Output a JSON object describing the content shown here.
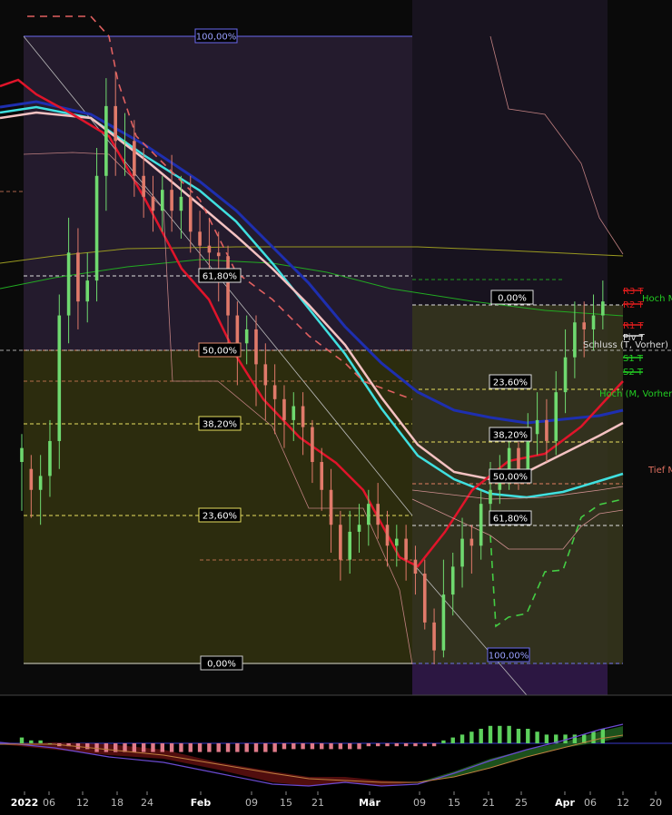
{
  "chart_data": {
    "type": "candlestick",
    "colors": {
      "background": "#000000",
      "up_candle": "#6fd96f",
      "down_candle": "#e07a6a",
      "ema_fast": "#e0142a",
      "ema_slow": "#f4c2c2",
      "ma_blue": "#1e2fb0",
      "ma_cyan": "#40e0e0",
      "ma_green_long": "#22aa22",
      "ma_olive": "#9a9a20",
      "fib_upper_box": "#3a2a4a",
      "fib_lower_box": "#3a3a10",
      "fib_right_box": "#3a3a1e",
      "fib_label_bg": "#000000",
      "pivot_resistance": "#e01c1c",
      "pivot_support": "#22cc22",
      "macd_pos": "#5cd05c",
      "macd_neg": "#e07a8a"
    },
    "x_ticks": [
      "2022",
      "06",
      "12",
      "18",
      "24",
      "Feb",
      "09",
      "15",
      "21",
      "Mär",
      "09",
      "15",
      "21",
      "25",
      "Apr",
      "06",
      "12",
      "20"
    ],
    "fib_levels_left": [
      "100,00%",
      "61,80%",
      "50,00%",
      "38,20%",
      "23,60%",
      "0,00%"
    ],
    "fib_levels_right": [
      "0,00%",
      "23,60%",
      "38,20%",
      "50,00%",
      "61,80%",
      "100,00%"
    ],
    "pivot_labels": [
      "R3 T",
      "R2 T",
      "R1 T",
      "Piv T",
      "S1 T",
      "S2 T"
    ],
    "line_labels": [
      "Hoch M",
      "Schluss (T, Vorher)",
      "Hoch (M, Vorher)",
      "Tief M"
    ],
    "candles": [
      [
        22,
        58,
        62,
        44,
        66
      ],
      [
        24,
        56,
        50,
        42,
        60
      ],
      [
        26,
        50,
        54,
        40,
        60
      ],
      [
        28,
        54,
        64,
        48,
        70
      ],
      [
        30,
        64,
        100,
        56,
        106
      ],
      [
        32,
        100,
        118,
        92,
        128
      ],
      [
        34,
        118,
        104,
        96,
        125
      ],
      [
        36,
        104,
        110,
        98,
        118
      ],
      [
        38,
        110,
        140,
        104,
        148
      ],
      [
        40,
        140,
        160,
        130,
        168
      ],
      [
        42,
        160,
        150,
        140,
        170
      ],
      [
        44,
        150,
        150,
        140,
        158
      ],
      [
        46,
        150,
        140,
        134,
        156
      ],
      [
        48,
        140,
        134,
        128,
        148
      ],
      [
        50,
        134,
        130,
        124,
        140
      ],
      [
        52,
        130,
        136,
        124,
        140
      ],
      [
        54,
        136,
        130,
        124,
        146
      ],
      [
        56,
        130,
        134,
        122,
        140
      ],
      [
        58,
        134,
        124,
        118,
        140
      ],
      [
        60,
        124,
        120,
        112,
        130
      ],
      [
        62,
        120,
        118,
        110,
        128
      ],
      [
        64,
        118,
        117,
        104,
        124
      ],
      [
        66,
        117,
        100,
        92,
        120
      ],
      [
        68,
        100,
        92,
        80,
        104
      ],
      [
        70,
        92,
        96,
        86,
        100
      ],
      [
        72,
        96,
        86,
        74,
        100
      ],
      [
        74,
        86,
        80,
        70,
        92
      ],
      [
        76,
        80,
        76,
        66,
        86
      ],
      [
        78,
        76,
        70,
        62,
        80
      ],
      [
        80,
        70,
        74,
        64,
        78
      ],
      [
        82,
        74,
        68,
        60,
        78
      ],
      [
        84,
        68,
        58,
        52,
        70
      ],
      [
        86,
        58,
        50,
        44,
        62
      ],
      [
        88,
        50,
        40,
        32,
        56
      ],
      [
        90,
        40,
        30,
        24,
        44
      ],
      [
        92,
        30,
        38,
        26,
        44
      ],
      [
        94,
        38,
        40,
        32,
        46
      ],
      [
        96,
        40,
        46,
        34,
        50
      ],
      [
        98,
        46,
        40,
        36,
        52
      ],
      [
        100,
        40,
        34,
        28,
        44
      ],
      [
        102,
        34,
        36,
        28,
        40
      ],
      [
        104,
        36,
        30,
        24,
        40
      ],
      [
        106,
        30,
        26,
        20,
        34
      ],
      [
        108,
        26,
        12,
        10,
        30
      ],
      [
        110,
        12,
        4,
        0,
        16
      ],
      [
        112,
        4,
        20,
        2,
        30
      ],
      [
        114,
        20,
        28,
        14,
        32
      ],
      [
        116,
        28,
        36,
        22,
        42
      ],
      [
        118,
        36,
        34,
        26,
        40
      ],
      [
        120,
        34,
        46,
        30,
        50
      ],
      [
        122,
        46,
        50,
        40,
        58
      ],
      [
        124,
        50,
        54,
        46,
        60
      ],
      [
        126,
        54,
        62,
        50,
        68
      ],
      [
        128,
        62,
        56,
        50,
        66
      ],
      [
        130,
        56,
        66,
        52,
        72
      ],
      [
        132,
        66,
        70,
        60,
        78
      ],
      [
        134,
        70,
        64,
        58,
        76
      ],
      [
        136,
        64,
        78,
        60,
        84
      ],
      [
        138,
        78,
        88,
        72,
        96
      ],
      [
        140,
        88,
        98,
        82,
        104
      ],
      [
        142,
        98,
        96,
        88,
        104
      ],
      [
        144,
        96,
        100,
        90,
        106
      ],
      [
        146,
        100,
        104,
        96,
        110
      ]
    ],
    "macd_hist": [
      [
        22,
        2
      ],
      [
        24,
        1
      ],
      [
        26,
        1
      ],
      [
        28,
        0
      ],
      [
        30,
        -1
      ],
      [
        32,
        -1
      ],
      [
        34,
        -2
      ],
      [
        36,
        -2
      ],
      [
        38,
        -3
      ],
      [
        40,
        -3
      ],
      [
        42,
        -3
      ],
      [
        44,
        -3
      ],
      [
        46,
        -3
      ],
      [
        48,
        -3
      ],
      [
        50,
        -3
      ],
      [
        52,
        -3
      ],
      [
        54,
        -3
      ],
      [
        56,
        -3
      ],
      [
        58,
        -3
      ],
      [
        60,
        -3
      ],
      [
        62,
        -3
      ],
      [
        64,
        -3
      ],
      [
        66,
        -3
      ],
      [
        68,
        -3
      ],
      [
        70,
        -3
      ],
      [
        72,
        -3
      ],
      [
        74,
        -3
      ],
      [
        76,
        -3
      ],
      [
        78,
        -2
      ],
      [
        80,
        -2
      ],
      [
        82,
        -2
      ],
      [
        84,
        -2
      ],
      [
        86,
        -2
      ],
      [
        88,
        -2
      ],
      [
        90,
        -2
      ],
      [
        92,
        -2
      ],
      [
        94,
        -2
      ],
      [
        96,
        -1
      ],
      [
        98,
        -1
      ],
      [
        100,
        -1
      ],
      [
        102,
        -1
      ],
      [
        104,
        -1
      ],
      [
        106,
        -1
      ],
      [
        108,
        -1
      ],
      [
        110,
        -1
      ],
      [
        112,
        1
      ],
      [
        114,
        2
      ],
      [
        116,
        3
      ],
      [
        118,
        4
      ],
      [
        120,
        5
      ],
      [
        122,
        6
      ],
      [
        124,
        6
      ],
      [
        126,
        6
      ],
      [
        128,
        5
      ],
      [
        130,
        5
      ],
      [
        132,
        4
      ],
      [
        134,
        3
      ],
      [
        136,
        3
      ],
      [
        138,
        3
      ],
      [
        140,
        3
      ],
      [
        142,
        3
      ],
      [
        144,
        4
      ],
      [
        146,
        5
      ]
    ]
  }
}
